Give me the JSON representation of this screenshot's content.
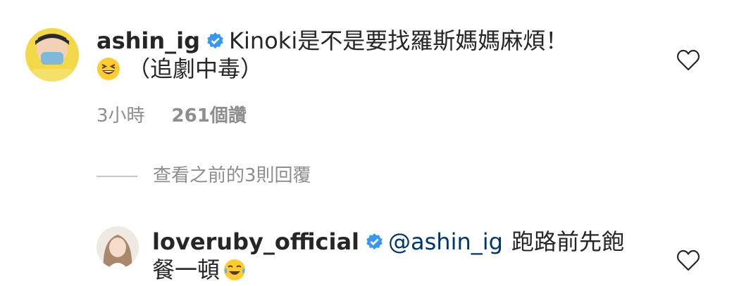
{
  "comments": [
    {
      "username": "ashin_ig",
      "text_line1": "Kinoki是不是要找羅斯媽媽麻煩！",
      "text_line2": "（追劇中毒）",
      "time": "3小時",
      "likes": "261個讚"
    },
    {
      "username": "loveruby_official",
      "mention": "@ashin_ig",
      "text_line1": "跑路前先飽",
      "text_line2": "餐一頓"
    }
  ],
  "view_replies": "查看之前的3則回覆",
  "icons": {
    "verified": "verified-badge-icon",
    "like": "heart-icon",
    "emoji1": "grinning-squinting-face-emoji",
    "emoji2": "face-with-tears-of-joy-emoji"
  },
  "colors": {
    "verified": "#3897f0",
    "text": "#262626",
    "secondary": "#8e8e8e",
    "mention": "#00376b"
  }
}
